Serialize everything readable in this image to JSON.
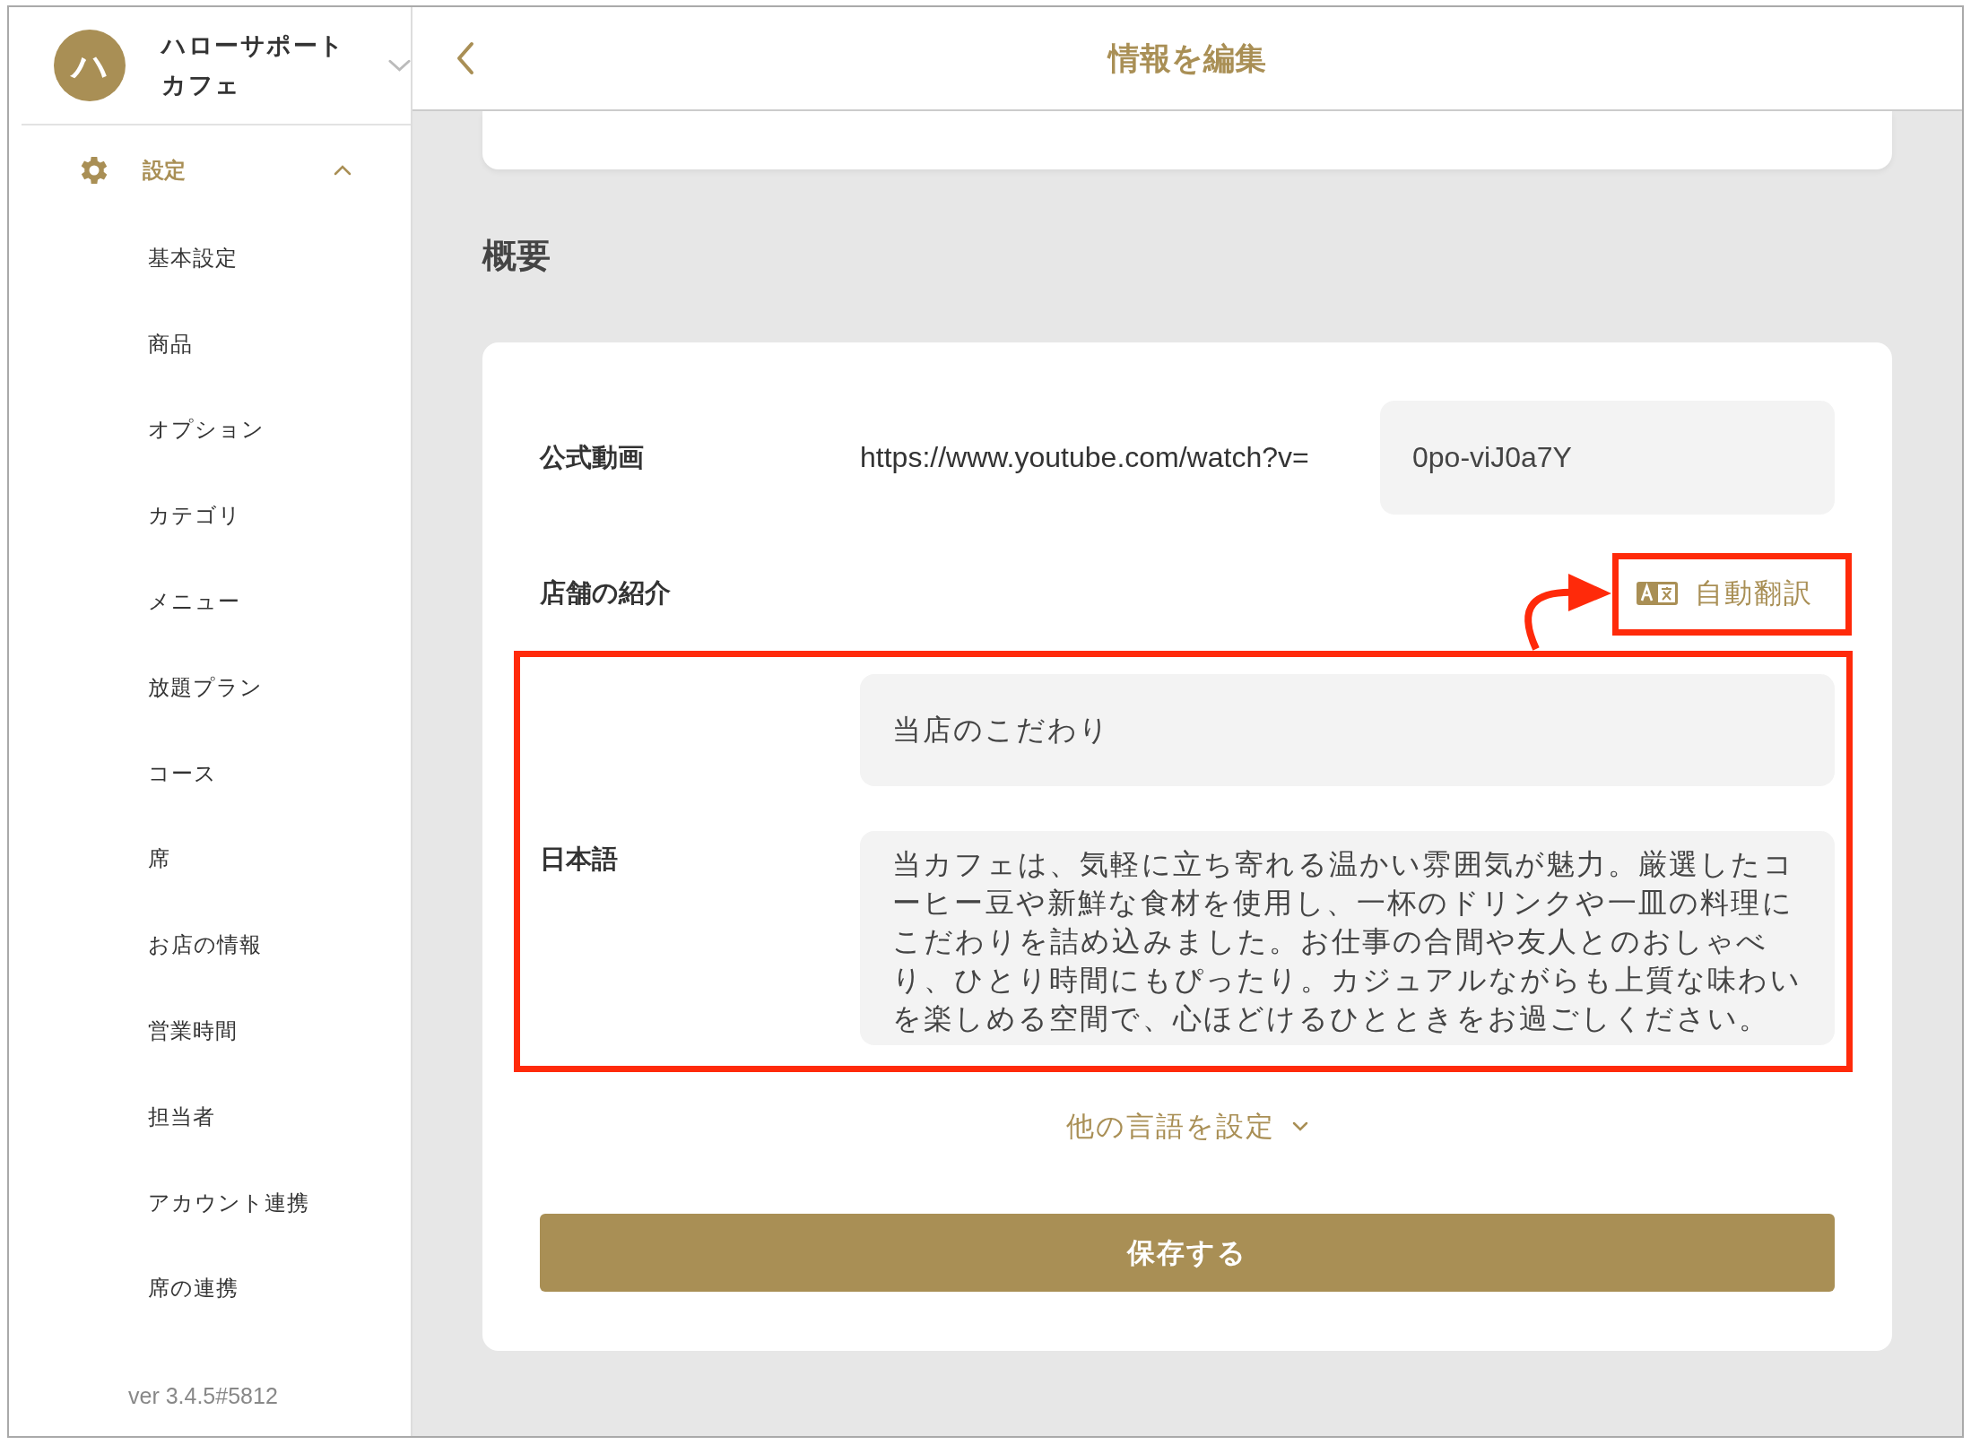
{
  "account": {
    "avatar": "ハ",
    "name": "ハローサポートカフェ"
  },
  "sidebar": {
    "section": {
      "label": "設定",
      "expanded": true
    },
    "items": [
      "基本設定",
      "商品",
      "オプション",
      "カテゴリ",
      "メニュー",
      "放題プラン",
      "コース",
      "席",
      "お店の情報",
      "営業時間",
      "担当者",
      "アカウント連携",
      "席の連携"
    ],
    "version": "ver 3.4.5#5812"
  },
  "header": {
    "title": "情報を編集"
  },
  "section_title": "概要",
  "form": {
    "video": {
      "label": "公式動画",
      "prefix": "https://www.youtube.com/watch?v=",
      "value": "0po-viJ0a7Y"
    },
    "intro": {
      "label": "店舗の紹介",
      "auto_translate": "自動翻訳"
    },
    "languages": [
      {
        "label": "日本語",
        "title": "当店のこだわり",
        "body": "当カフェは、気軽に立ち寄れる温かい雰囲気が魅力。厳選したコーヒー豆や新鮮な食材を使用し、一杯のドリンクや一皿の料理にこだわりを詰め込みました。お仕事の合間や友人とのおしゃべり、ひとり時間にもぴったり。カジュアルながらも上質な味わいを楽しめる空間で、心ほどけるひとときをお過ごしください。"
      }
    ],
    "more_languages": "他の言語を設定",
    "save": "保存する"
  }
}
